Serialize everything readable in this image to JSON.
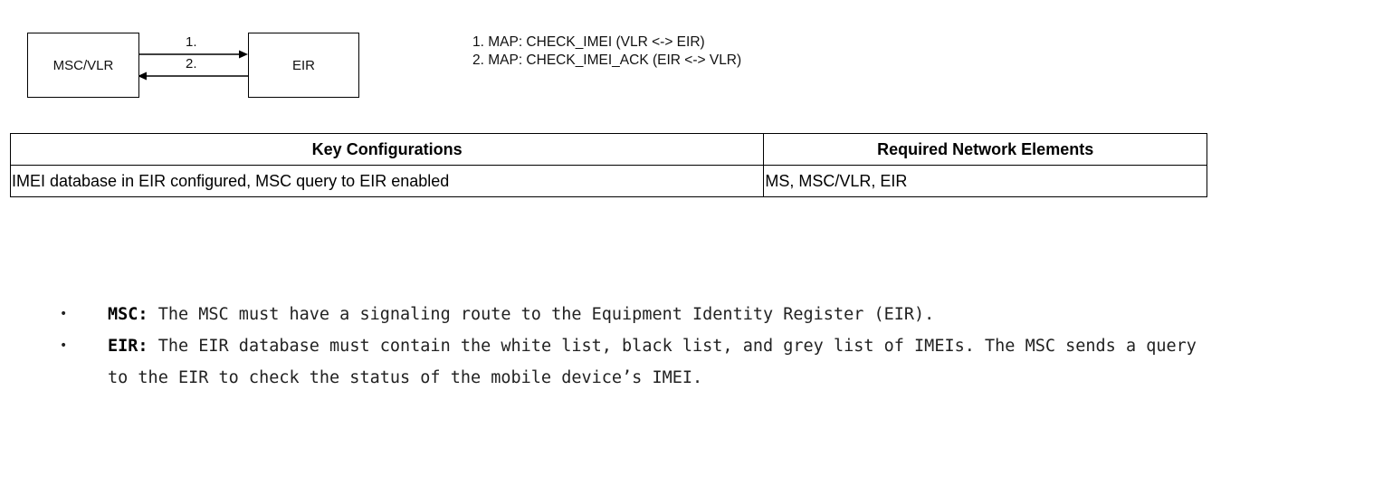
{
  "diagram": {
    "nodes": {
      "msc": "MSC/VLR",
      "eir": "EIR"
    },
    "steps": {
      "step1": "1.",
      "step2": "2."
    },
    "legend": {
      "line1": "1. MAP: CHECK_IMEI (VLR <-> EIR)",
      "line2": "2. MAP: CHECK_IMEI_ACK (EIR <-> VLR)"
    }
  },
  "table": {
    "headers": {
      "col1": "Key Configurations",
      "col2": "Required Network Elements"
    },
    "rows": [
      {
        "config": "IMEI database in EIR configured, MSC query to EIR enabled",
        "elements": "MS, MSC/VLR, EIR"
      }
    ]
  },
  "notes": [
    {
      "bullet": "•",
      "term": "MSC:",
      "text": " The MSC must have a signaling route to the Equipment Identity Register (EIR)."
    },
    {
      "bullet": "•",
      "term": "EIR:",
      "text": " The EIR database must contain the white list, black list, and grey list of IMEIs. The MSC sends a query to the EIR to check the status of the mobile device’s IMEI."
    }
  ]
}
